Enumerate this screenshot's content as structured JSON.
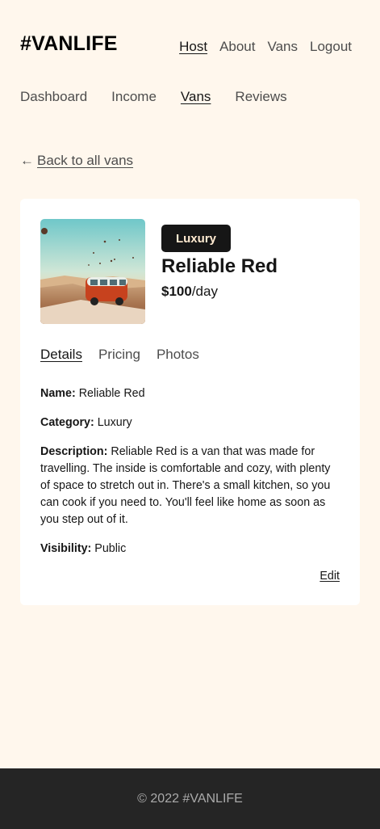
{
  "header": {
    "logo": "#VANLIFE",
    "nav": [
      {
        "label": "Host",
        "active": true
      },
      {
        "label": "About",
        "active": false
      },
      {
        "label": "Vans",
        "active": false
      },
      {
        "label": "Logout",
        "active": false
      }
    ]
  },
  "host_nav": [
    {
      "label": "Dashboard",
      "active": false
    },
    {
      "label": "Income",
      "active": false
    },
    {
      "label": "Vans",
      "active": true
    },
    {
      "label": "Reviews",
      "active": false
    }
  ],
  "back_link": {
    "arrow": "←",
    "label": "Back to all vans"
  },
  "van": {
    "image_icon": "van-photo",
    "type": "Luxury",
    "name": "Reliable Red",
    "price": "$100",
    "price_unit": "/day",
    "tabs": [
      {
        "label": "Details",
        "active": true
      },
      {
        "label": "Pricing",
        "active": false
      },
      {
        "label": "Photos",
        "active": false
      }
    ],
    "details": {
      "name_label": "Name:",
      "name_value": "Reliable Red",
      "category_label": "Category:",
      "category_value": "Luxury",
      "description_label": "Description:",
      "description_value": "Reliable Red is a van that was made for travelling. The inside is comfortable and cozy, with plenty of space to stretch out in. There's a small kitchen, so you can cook if you need to. You'll feel like home as soon as you step out of it.",
      "visibility_label": "Visibility:",
      "visibility_value": "Public"
    },
    "edit_label": "Edit"
  },
  "footer": {
    "text": "© 2022 #VANLIFE"
  },
  "colors": {
    "background": "#FFF7ED",
    "badge_bg": "#161616",
    "badge_text": "#FFEAD0",
    "footer_bg": "#252525",
    "footer_text": "#AAAAAA"
  }
}
